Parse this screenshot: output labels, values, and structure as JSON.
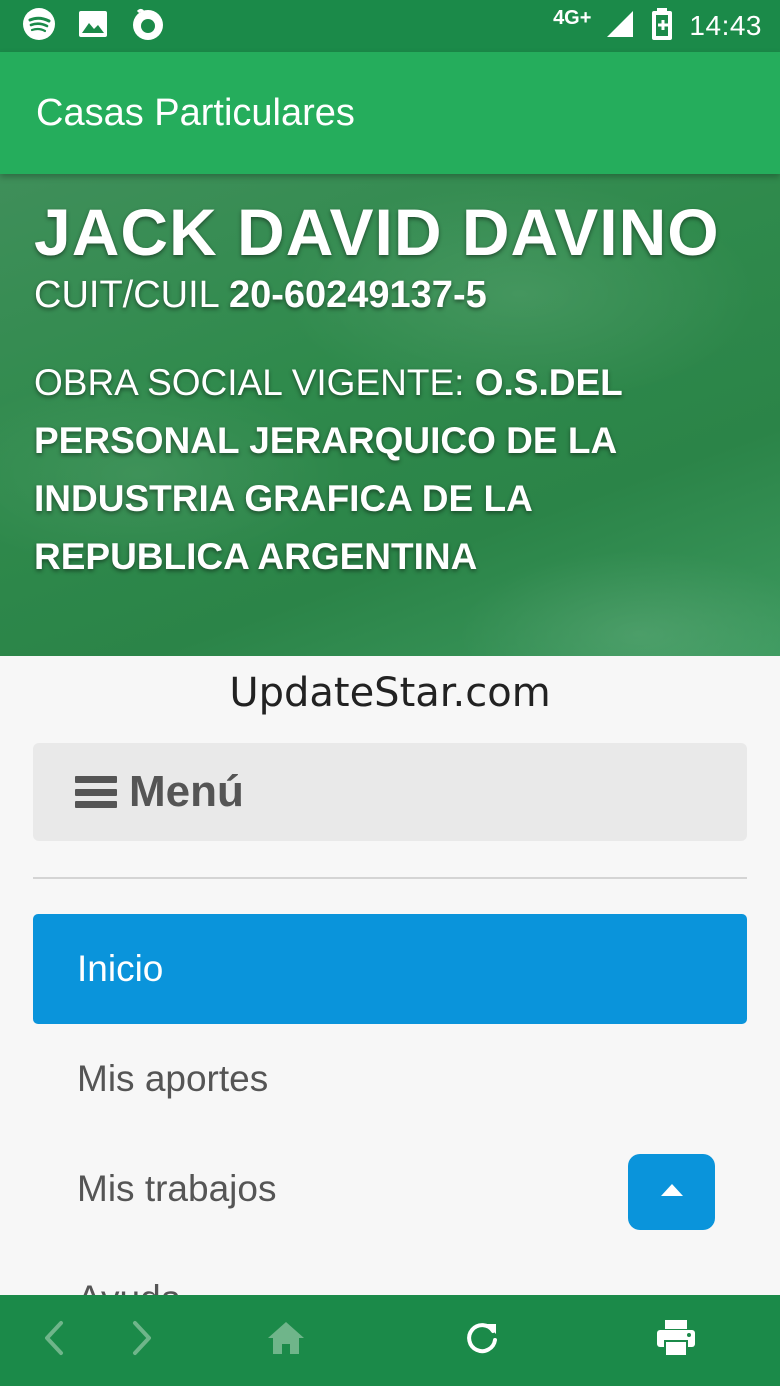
{
  "status_bar": {
    "time": "14:43",
    "network": "4G+",
    "icons": [
      "spotify-icon",
      "image-icon",
      "firefox-icon",
      "signal-icon",
      "battery-charging-icon"
    ]
  },
  "app_bar": {
    "title": "Casas Particulares"
  },
  "profile": {
    "name": "JACK DAVID DAVINO",
    "cuit_label": "CUIT/CUIL",
    "cuit_value": "20-60249137-5",
    "obra_label": "OBRA SOCIAL VIGENTE:",
    "obra_value": "O.S.DEL PERSONAL JERARQUICO DE LA INDUSTRIA GRAFICA DE LA REPUBLICA ARGENTINA"
  },
  "site": {
    "name": "UpdateStar.com"
  },
  "menu": {
    "label": "Menú",
    "items": [
      {
        "label": "Inicio",
        "active": true
      },
      {
        "label": "Mis aportes",
        "active": false
      },
      {
        "label": "Mis trabajos",
        "active": false
      },
      {
        "label": "Ayuda",
        "active": false
      }
    ]
  },
  "bottom_bar": {
    "icons": [
      "back-icon",
      "forward-icon",
      "home-icon",
      "refresh-icon",
      "print-icon"
    ]
  },
  "colors": {
    "status_bar": "#1b8a49",
    "app_bar": "#25ad5c",
    "accent": "#0a94db",
    "bottom_bar": "#1b8a49"
  }
}
